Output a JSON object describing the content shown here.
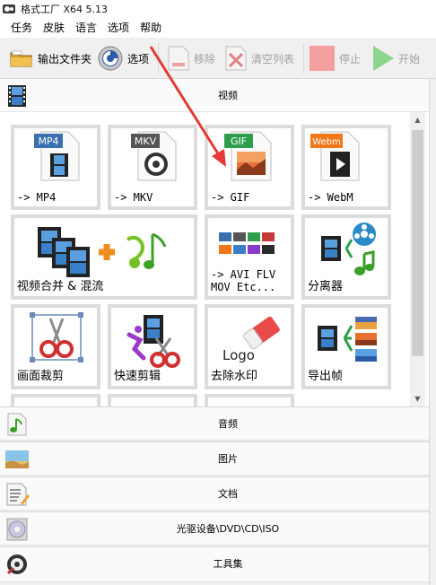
{
  "window": {
    "title": "格式工厂 X64 5.13"
  },
  "menu": [
    "任务",
    "皮肤",
    "语言",
    "选项",
    "帮助"
  ],
  "toolbar": {
    "output_folder": "输出文件夹",
    "options": "选项",
    "remove": "移除",
    "clear_list": "清空列表",
    "stop": "停止",
    "start": "开始"
  },
  "categories": {
    "video": "视频",
    "audio": "音频",
    "picture": "图片",
    "document": "文档",
    "rom": "光驱设备\\DVD\\CD\\ISO",
    "tools": "工具集"
  },
  "tiles": {
    "mp4": {
      "badge": "MP4",
      "label": "-> MP4"
    },
    "mkv": {
      "badge": "MKV",
      "label": "-> MKV"
    },
    "gif": {
      "badge": "GIF",
      "label": "-> GIF"
    },
    "webm": {
      "badge": "Webm",
      "label": "-> WebM"
    },
    "merge": {
      "label": "视频合并 & 混流"
    },
    "avi": {
      "label": "-> AVI FLV\nMOV Etc..."
    },
    "splitter": {
      "label": "分离器"
    },
    "crop": {
      "label": "画面裁剪"
    },
    "quickcut": {
      "label": "快速剪辑"
    },
    "watermark": {
      "label": "去除水印",
      "logo_text": "Logo"
    },
    "frames": {
      "label": "导出帧"
    }
  },
  "colors": {
    "mp4": "#3a6fb0",
    "mkv": "#555555",
    "gif": "#2e9e4e",
    "webm": "#f07818",
    "stop": "#f4a0a0",
    "start": "#8ed48e",
    "arrow": "#e53935"
  }
}
